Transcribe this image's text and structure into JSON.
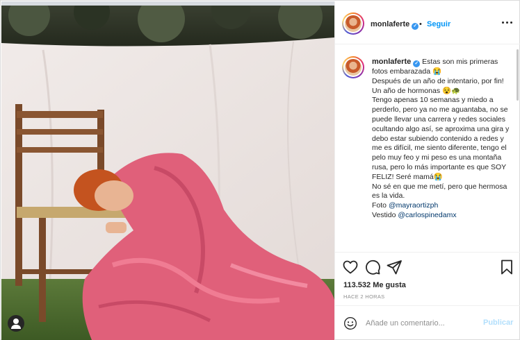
{
  "post": {
    "username": "monlaferte",
    "verified": true,
    "follow_label": "Seguir",
    "separator": "•",
    "caption": {
      "line1": "Estas son mis primeras fotos embarazada 😭",
      "line2": "Después de un año de intentario, por fin!",
      "line3": "Un año de hormonas 😵🐢",
      "line4": "Tengo apenas 10 semanas y miedo a perderlo, pero ya no me aguantaba, no se puede llevar una carrera y redes sociales ocultando algo así, se aproxima una gira y debo estar subiendo contenido a redes y me es difícil, me siento diferente, tengo el pelo muy feo y mi peso es una montaña rusa, pero lo más importante es que SOY FELIZ! Seré mamá😭",
      "line5": "No sé en que me metí, pero que hermosa es la vida.",
      "foto_label": "Foto",
      "foto_mention": "@mayraortizph",
      "vestido_label": "Vestido",
      "vestido_mention": "@carlospinedamx"
    },
    "likes": "113.532 Me gusta",
    "timestamp": "HACE 2 HORAS",
    "comment_placeholder": "Añade un comentario...",
    "publish_label": "Publicar"
  },
  "icons": {
    "more": "more-options-icon",
    "like": "heart-icon",
    "comment": "comment-bubble-icon",
    "share": "paper-plane-icon",
    "save": "bookmark-icon",
    "emoji": "smiley-icon",
    "user_tag": "user-tag-icon"
  },
  "colors": {
    "link_blue": "#0095f6",
    "publish_disabled": "#b2dffc",
    "dress_pink": "#e0607a",
    "backdrop": "#ede7e5"
  }
}
